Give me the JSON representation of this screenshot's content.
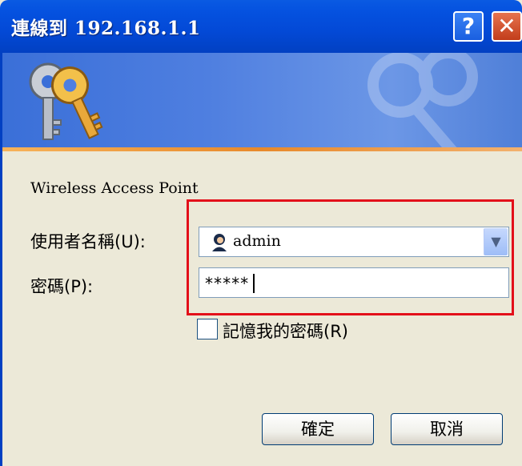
{
  "window": {
    "title": "連線到 192.168.1.1",
    "help_label": "?",
    "close_label": "✕"
  },
  "banner": {
    "icon": "keys-icon"
  },
  "dialog": {
    "realm": "Wireless Access Point",
    "username_label": "使用者名稱(U):",
    "username_value": "admin",
    "password_label": "密碼(P):",
    "password_value": "*****",
    "remember_label": "記憶我的密碼(R)",
    "remember_checked": false,
    "ok_label": "確定",
    "cancel_label": "取消"
  },
  "colors": {
    "titlebar": "#0349d6",
    "highlight_box": "#e3101a",
    "dialog_bg": "#ece9d8"
  }
}
